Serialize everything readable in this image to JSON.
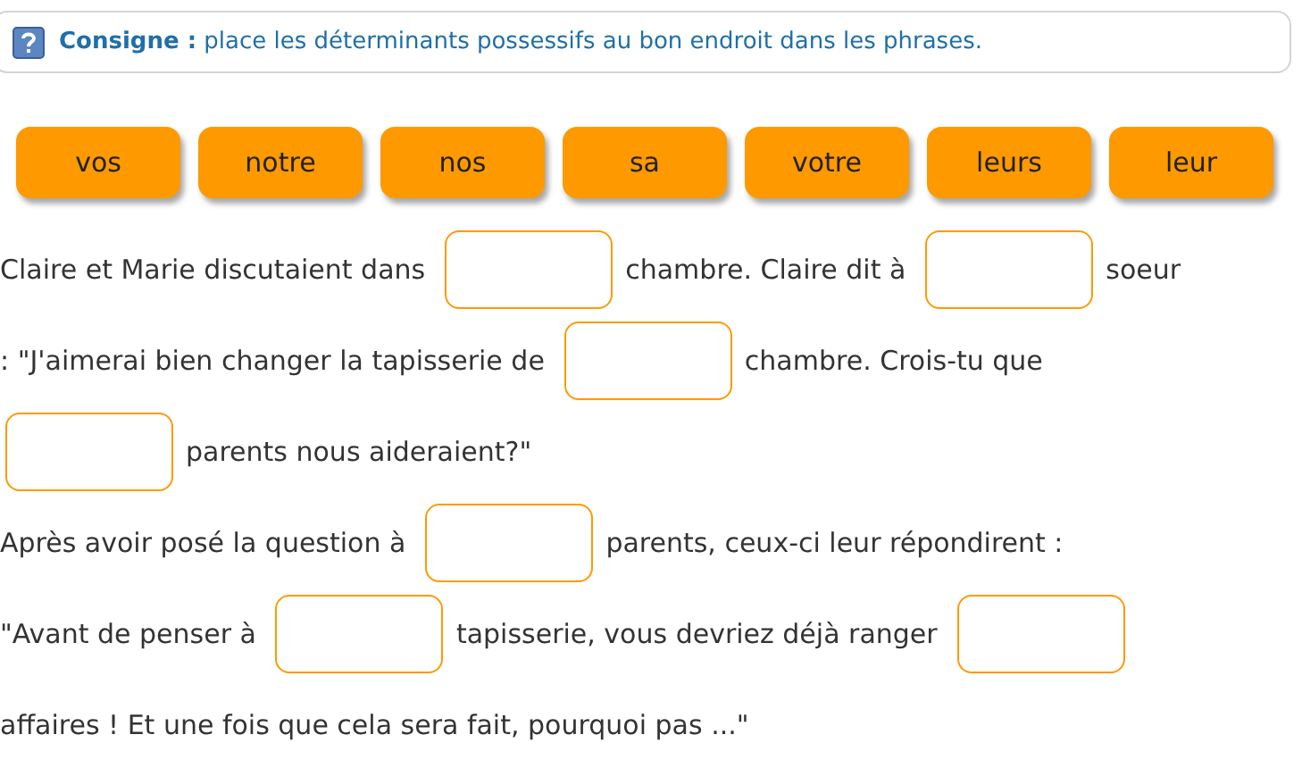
{
  "instruction": {
    "label": "Consigne :",
    "text": "place les déterminants possessifs au bon endroit dans les phrases."
  },
  "word_bank": [
    "vos",
    "notre",
    "nos",
    "sa",
    "votre",
    "leurs",
    "leur"
  ],
  "lines": [
    {
      "segments": [
        {
          "kind": "text",
          "text": "Claire et Marie discutaient dans"
        },
        {
          "kind": "blank"
        },
        {
          "kind": "text",
          "text": "chambre. Claire dit à"
        },
        {
          "kind": "blank"
        },
        {
          "kind": "text",
          "text": "soeur"
        }
      ]
    },
    {
      "segments": [
        {
          "kind": "text",
          "text": ": \"J'aimerai bien changer la tapisserie de"
        },
        {
          "kind": "blank"
        },
        {
          "kind": "text",
          "text": "chambre. Crois-tu que"
        }
      ]
    },
    {
      "segments": [
        {
          "kind": "blank"
        },
        {
          "kind": "text",
          "text": "parents nous aideraient?\""
        }
      ]
    },
    {
      "segments": [
        {
          "kind": "text",
          "text": "Après avoir posé la question à"
        },
        {
          "kind": "blank"
        },
        {
          "kind": "text",
          "text": "parents, ceux-ci leur répondirent :"
        }
      ]
    },
    {
      "segments": [
        {
          "kind": "text",
          "text": "\"Avant de penser à"
        },
        {
          "kind": "blank"
        },
        {
          "kind": "text",
          "text": "tapisserie, vous devriez déjà ranger"
        },
        {
          "kind": "blank"
        }
      ]
    },
    {
      "segments": [
        {
          "kind": "text",
          "text": "affaires ! Et une fois que cela sera fait, pourquoi pas ...\""
        }
      ]
    }
  ]
}
